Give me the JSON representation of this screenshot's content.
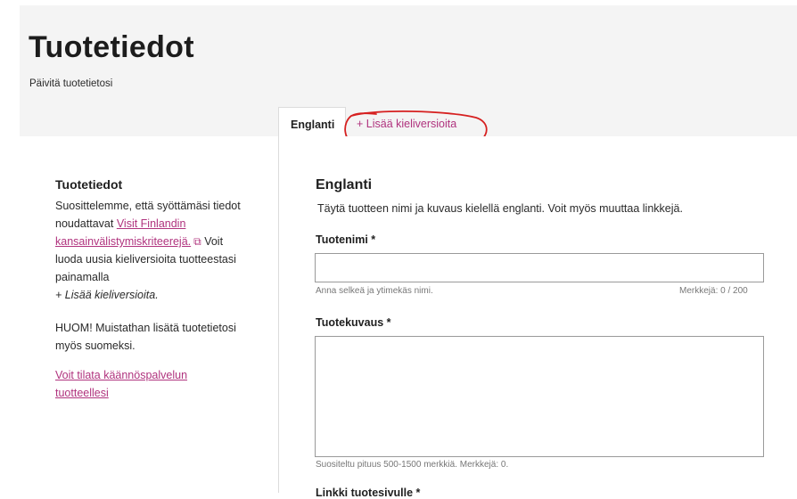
{
  "header": {
    "title": "Tuotetiedot",
    "subtitle": "Päivitä tuotetietosi"
  },
  "tabs": {
    "active_label": "Englanti",
    "add_label": "+ Lisää kieliversioita"
  },
  "sidebar": {
    "title": "Tuotetiedot",
    "intro_before_link": "Suosittelemme, että syöttämäsi tiedot noudattavat ",
    "criteria_link": "Visit Finlandin kansainvälistymiskriteerejä.",
    "external_icon": "external-link-icon",
    "intro_after_link": " Voit luoda uusia kieliversioita tuotteestasi painamalla",
    "intro_italic": "+ Lisää kieliversioita.",
    "note": "HUOM! Muistathan lisätä tuotetietosi myös suomeksi.",
    "translation_link": "Voit tilata käännöspalvelun tuotteellesi"
  },
  "form": {
    "section_title": "Englanti",
    "section_description": "Täytä tuotteen nimi ja kuvaus kielellä englanti. Voit myös muuttaa linkkejä.",
    "name_label": "Tuotenimi *",
    "name_value": "",
    "name_hint": "Anna selkeä ja ytimekäs nimi.",
    "name_counter": "Merkkejä: 0 / 200",
    "description_label": "Tuotekuvaus *",
    "description_value": "",
    "description_hint": "Suositeltu pituus 500-1500 merkkiä. Merkkejä: 0.",
    "link_label": "Linkki tuotesivulle *"
  },
  "colors": {
    "accent": "#b0337e",
    "annotation": "#d62020",
    "header_background": "#f4f4f4"
  }
}
